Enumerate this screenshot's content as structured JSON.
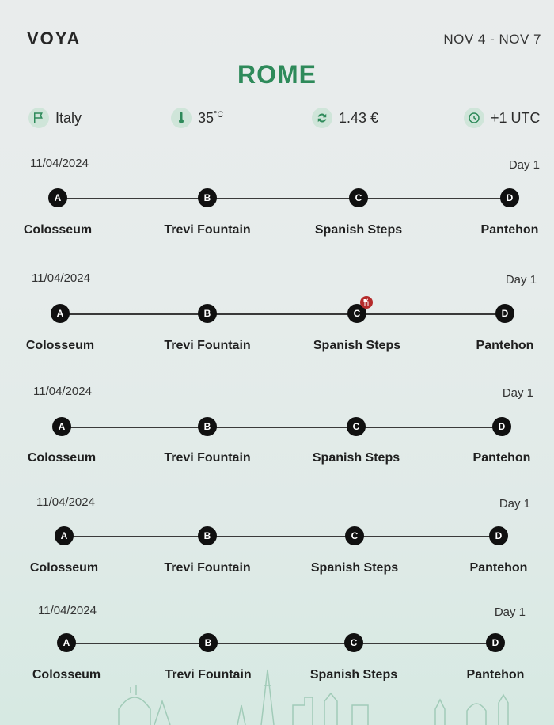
{
  "app": {
    "logo": "VOYA",
    "date_range": "NOV 4 - NOV 7"
  },
  "city": "ROME",
  "info": {
    "country": "Italy",
    "temperature": "35",
    "temperature_unit": "°C",
    "currency": "1.43 €",
    "timezone": "+1 UTC",
    "icons": [
      "flag-icon",
      "thermometer-icon",
      "currency-exchange-icon",
      "clock-icon"
    ]
  },
  "days": [
    {
      "date": "11/04/2024",
      "label": "Day 1",
      "stops": [
        {
          "letter": "A",
          "name": "Colosseum"
        },
        {
          "letter": "B",
          "name": "Trevi Fountain"
        },
        {
          "letter": "C",
          "name": "Spanish Steps"
        },
        {
          "letter": "D",
          "name": "Pantehon"
        }
      ]
    },
    {
      "date": "11/04/2024",
      "label": "Day 1",
      "stops": [
        {
          "letter": "A",
          "name": "Colosseum"
        },
        {
          "letter": "B",
          "name": "Trevi Fountain"
        },
        {
          "letter": "C",
          "name": "Spanish Steps",
          "badge": "restaurant-icon"
        },
        {
          "letter": "D",
          "name": "Pantehon"
        }
      ]
    },
    {
      "date": "11/04/2024",
      "label": "Day 1",
      "stops": [
        {
          "letter": "A",
          "name": "Colosseum"
        },
        {
          "letter": "B",
          "name": "Trevi Fountain"
        },
        {
          "letter": "C",
          "name": "Spanish Steps"
        },
        {
          "letter": "D",
          "name": "Pantehon"
        }
      ]
    },
    {
      "date": "11/04/2024",
      "label": "Day 1",
      "stops": [
        {
          "letter": "A",
          "name": "Colosseum"
        },
        {
          "letter": "B",
          "name": "Trevi Fountain"
        },
        {
          "letter": "C",
          "name": "Spanish Steps"
        },
        {
          "letter": "D",
          "name": "Pantehon"
        }
      ]
    },
    {
      "date": "11/04/2024",
      "label": "Day 1",
      "stops": [
        {
          "letter": "A",
          "name": "Colosseum"
        },
        {
          "letter": "B",
          "name": "Trevi Fountain"
        },
        {
          "letter": "C",
          "name": "Spanish Steps"
        },
        {
          "letter": "D",
          "name": "Pantehon"
        }
      ]
    }
  ],
  "colors": {
    "accent": "#2e8a5a",
    "icon_bg": "#cfe5d9",
    "stop": "#101010",
    "badge": "#b52b2b"
  }
}
